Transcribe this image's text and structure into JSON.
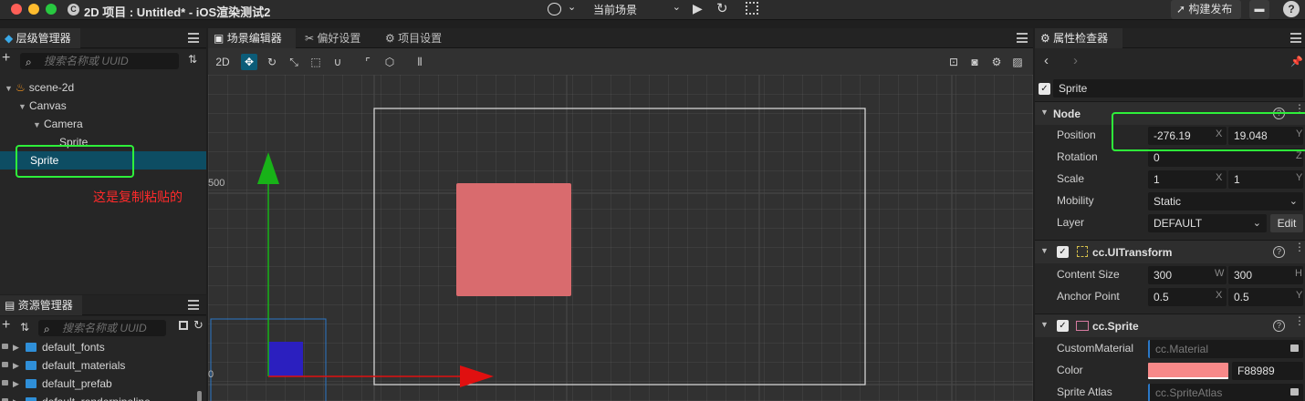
{
  "window": {
    "title": "2D 项目 : Untitled* - iOS渲染测试2",
    "app_icon": "C"
  },
  "toolbar": {
    "scene_select": "当前场景",
    "chevron": "⌄",
    "play": "▶",
    "refresh": "↻",
    "build_label": "构建发布",
    "folder": "▬",
    "help": "?"
  },
  "hierarchy": {
    "tab_label": "层级管理器",
    "search_placeholder": "搜索名称或 UUID",
    "add": "+",
    "sort": "⇅",
    "nodes": [
      {
        "label": "scene-2d"
      },
      {
        "label": "Canvas"
      },
      {
        "label": "Camera"
      },
      {
        "label": "Sprite"
      },
      {
        "label": "Sprite"
      }
    ],
    "annotation": "这是复制粘贴的"
  },
  "assets": {
    "tab_label": "资源管理器",
    "search_placeholder": "搜索名称或 UUID",
    "add": "+",
    "sort": "⇅",
    "refresh": "↻",
    "items": [
      {
        "label": "default_fonts"
      },
      {
        "label": "default_materials"
      },
      {
        "label": "default_prefab"
      },
      {
        "label": "default_renderpipeline"
      }
    ]
  },
  "scene": {
    "tabs": [
      {
        "label": "场景编辑器"
      },
      {
        "label": "偏好设置"
      },
      {
        "label": "项目设置"
      }
    ],
    "mode_2d": "2D",
    "ruler_500": "500",
    "ruler_0": "0",
    "colors": {
      "sprite": "#d96b6e",
      "gizmo_x": "#e01010",
      "gizmo_y": "#18b318",
      "grid_major": "#4a4a4a"
    }
  },
  "inspector": {
    "tab_label": "属性检查器",
    "node_name": "Sprite",
    "node_section": "Node",
    "position": {
      "label": "Position",
      "x": "-276.19",
      "y": "19.048"
    },
    "rotation": {
      "label": "Rotation",
      "z": "0"
    },
    "scale": {
      "label": "Scale",
      "x": "1",
      "y": "1"
    },
    "mobility": {
      "label": "Mobility",
      "value": "Static"
    },
    "layer": {
      "label": "Layer",
      "value": "DEFAULT",
      "edit": "Edit"
    },
    "uitransform": {
      "title": "cc.UITransform",
      "content_size": {
        "label": "Content Size",
        "w": "300",
        "h": "300"
      },
      "anchor_point": {
        "label": "Anchor Point",
        "x": "0.5",
        "y": "0.5"
      }
    },
    "sprite": {
      "title": "cc.Sprite",
      "custom_material": {
        "label": "CustomMaterial",
        "value": "cc.Material"
      },
      "color": {
        "label": "Color",
        "hex": "F88989",
        "swatch": "#f88989"
      },
      "sprite_atlas": {
        "label": "Sprite Atlas",
        "value": "cc.SpriteAtlas"
      }
    },
    "axis": {
      "x": "X",
      "y": "Y",
      "z": "Z",
      "w": "W",
      "h": "H"
    },
    "help": "?",
    "kebab": "⋮",
    "check": "✓"
  }
}
